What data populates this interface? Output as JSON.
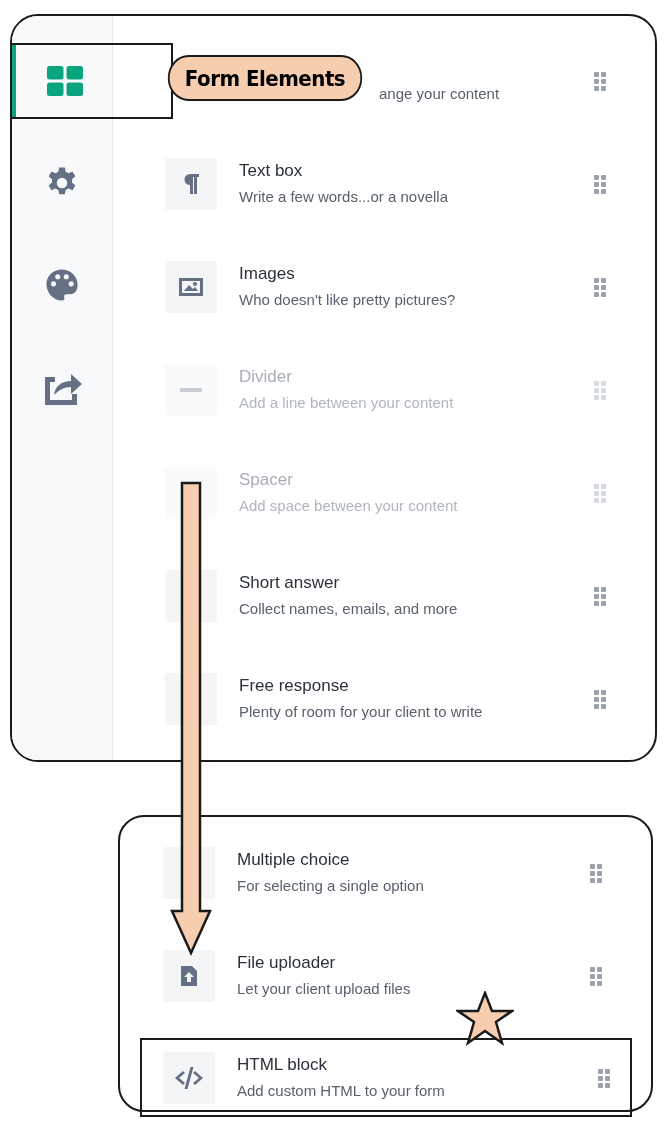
{
  "callout": {
    "text": "Form Elements"
  },
  "sidebar": {
    "items": [
      {
        "selected": true
      },
      {
        "selected": false
      },
      {
        "selected": false
      },
      {
        "selected": false
      }
    ]
  },
  "elements": [
    {
      "description": "ange your content",
      "disabled": false
    },
    {
      "title": "Text box",
      "description": "Write a few words...or a novella",
      "disabled": false
    },
    {
      "title": "Images",
      "description": "Who doesn't like pretty pictures?",
      "disabled": false
    },
    {
      "title": "Divider",
      "description": "Add a line between your content",
      "disabled": true
    },
    {
      "title": "Spacer",
      "description": "Add space between your content",
      "disabled": true
    },
    {
      "title": "Short answer",
      "description": "Collect names, emails, and more",
      "disabled": false
    },
    {
      "title": "Free response",
      "description": "Plenty of room for your client to write",
      "disabled": false
    }
  ],
  "more_elements": [
    {
      "title": "Multiple choice",
      "description": "For selecting a single option",
      "highlighted": false
    },
    {
      "title": "File uploader",
      "description": "Let your client upload files",
      "highlighted": false
    },
    {
      "title": "HTML block",
      "description": "Add custom HTML to your form",
      "highlighted": true
    }
  ]
}
